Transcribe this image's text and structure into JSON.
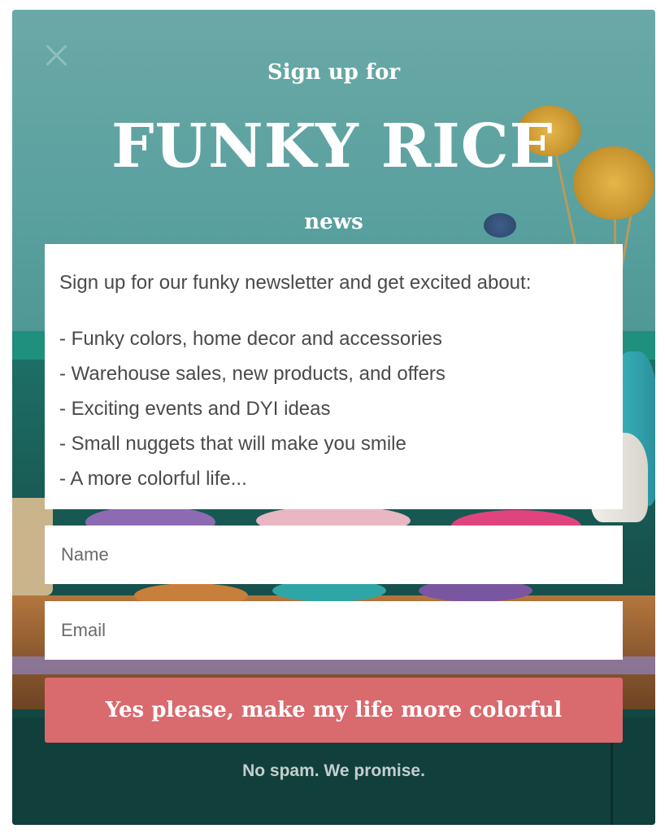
{
  "popup": {
    "close_icon": "close-icon",
    "kicker": "Sign up for",
    "brand": "FUNKY RICE",
    "tagline": "news",
    "intro": "Sign up for our funky newsletter and get excited about:",
    "benefits": [
      "- Funky colors, home decor and accessories",
      "- Warehouse sales, new products, and offers",
      "- Exciting events and DYI ideas",
      "- Small nuggets that will make you smile",
      "- A more colorful life..."
    ],
    "name_placeholder": "Name",
    "email_placeholder": "Email",
    "submit_label": "Yes please, make my life more colorful",
    "disclaimer": "No spam. We promise."
  },
  "colors": {
    "button": "#d96a6e",
    "heading_text": "#ffffff",
    "body_text": "#4a4a4a"
  }
}
